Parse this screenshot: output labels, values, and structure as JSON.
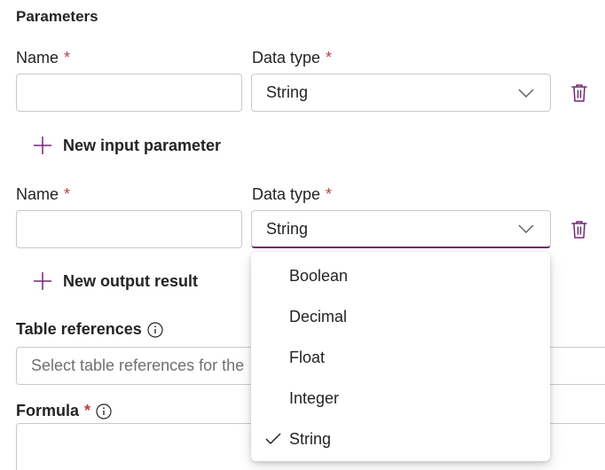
{
  "parameters": {
    "title": "Parameters"
  },
  "input_row": {
    "name_label": "Name",
    "required_marker": "*",
    "datatype_label": "Data type",
    "name_value": "",
    "datatype_value": "String"
  },
  "add_input": {
    "label": "New input parameter"
  },
  "output_row": {
    "name_label": "Name",
    "required_marker": "*",
    "datatype_label": "Data type",
    "name_value": "",
    "datatype_value": "String"
  },
  "add_output": {
    "label": "New output result"
  },
  "table_references": {
    "label": "Table references",
    "placeholder": "Select table references for the"
  },
  "formula": {
    "label": "Formula",
    "required_marker": "*"
  },
  "dropdown": {
    "options": [
      {
        "label": "Boolean",
        "selected": false
      },
      {
        "label": "Decimal",
        "selected": false
      },
      {
        "label": "Float",
        "selected": false
      },
      {
        "label": "Integer",
        "selected": false
      },
      {
        "label": "String",
        "selected": true
      }
    ]
  },
  "colors": {
    "accent": "#742774",
    "required": "#b63f4a",
    "border": "#c9c9c9"
  }
}
